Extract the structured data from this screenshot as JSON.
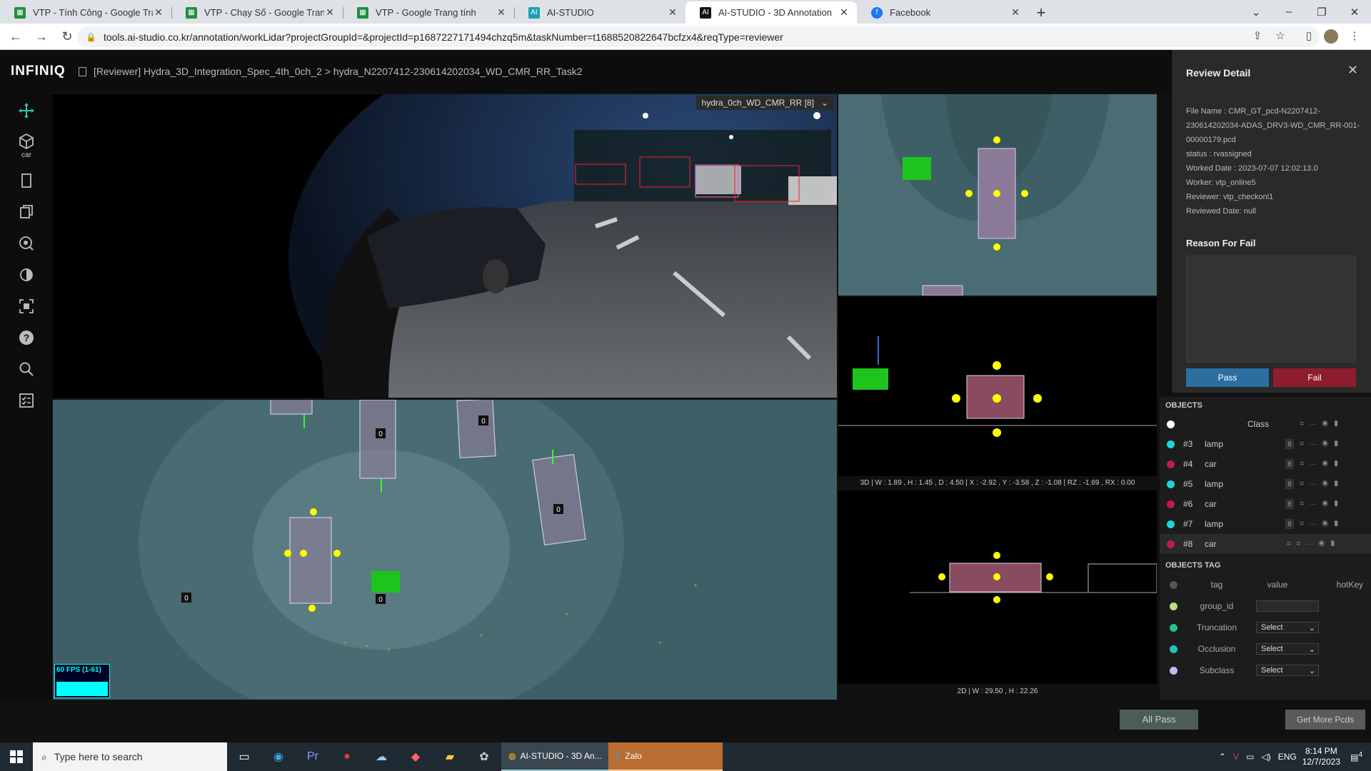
{
  "browser": {
    "tabs": [
      {
        "label": "VTP - Tính Công - Google Trang",
        "icon": "sheets-icon",
        "color": "#1e8e3e"
      },
      {
        "label": "VTP - Chạy Số - Google Trang tín",
        "icon": "sheets-icon",
        "color": "#1e8e3e"
      },
      {
        "label": "VTP - Google Trang tính",
        "icon": "sheets-icon",
        "color": "#1e8e3e"
      },
      {
        "label": "AI-STUDIO",
        "icon": "ai-studio-icon",
        "color": "#1a9fb0"
      },
      {
        "label": "AI-STUDIO - 3D Annotation",
        "icon": "ai-studio-icon",
        "color": "#1a9fb0"
      },
      {
        "label": "Facebook",
        "icon": "facebook-icon",
        "color": "#1877f2"
      }
    ],
    "url": "tools.ai-studio.co.kr/annotation/workLidar?projectGroupId=&projectId=p1687227171494chzq5m&taskNumber=t1688520822647bcfzx4&reqType=reviewer"
  },
  "app": {
    "logo": "INFINIQ",
    "breadcrumb": "[Reviewer] Hydra_3D_Integration_Spec_4th_0ch_2 > hydra_N2207412-230614202034_WD_CMR_RR_Task2",
    "tool_label_car": "car",
    "camera_select": "hydra_0ch_WD_CMR_RR [8]",
    "fps": "60 FPS (1-61)",
    "box_labels": [
      "0",
      "0",
      "0",
      "0",
      "0",
      "0"
    ],
    "info_3d": "3D | W : 1.89 , H : 1.45 , D : 4.50 | X : -2.92 , Y : -3.58 , Z : -1.08 | RZ : -1.69 , RX : 0.00",
    "info_2d": "2D | W : 29.50 , H : 22.26"
  },
  "review": {
    "title": "Review Detail",
    "file_name": "File Name : CMR_GT_pcd-N2207412-230614202034-ADAS_DRV3-WD_CMR_RR-001-00000179.pcd",
    "status": "status : rvassigned",
    "worked_date": "Worked Date : 2023-07-07 12:02:13.0",
    "worker": "Worker: vtp_online5",
    "reviewer": "Reviewer: vtp_checkonl1",
    "reviewed_date": "Reviewed Date: null",
    "reason_title": "Reason For Fail",
    "pass": "Pass",
    "fail": "Fail"
  },
  "objects": {
    "header": "OBJECTS",
    "class_col": "Class",
    "rows": [
      {
        "id": "#3",
        "cls": "lamp",
        "color": "#22d3e0",
        "hotkey": "8"
      },
      {
        "id": "#4",
        "cls": "car",
        "color": "#c2185b",
        "hotkey": "8"
      },
      {
        "id": "#5",
        "cls": "lamp",
        "color": "#22d3e0",
        "hotkey": "8"
      },
      {
        "id": "#6",
        "cls": "car",
        "color": "#c2185b",
        "hotkey": "8"
      },
      {
        "id": "#7",
        "cls": "lamp",
        "color": "#22d3e0",
        "hotkey": "8"
      },
      {
        "id": "#8",
        "cls": "car",
        "color": "#c2185b",
        "hotkey": ""
      }
    ]
  },
  "tags": {
    "header": "OBJECTS TAG",
    "col_tag": "tag",
    "col_value": "value",
    "col_hotkey": "hotKey",
    "rows": [
      {
        "name": "group_id",
        "color": "#b6e07a",
        "value": ""
      },
      {
        "name": "Truncation",
        "color": "#22c48a",
        "value": "Select"
      },
      {
        "name": "Occlusion",
        "color": "#22c4b5",
        "value": "Select"
      },
      {
        "name": "Subclass",
        "color": "#c8b8ef",
        "value": "Select"
      }
    ]
  },
  "bottom": {
    "all_pass": "All Pass",
    "get_more": "Get More Pcds"
  },
  "taskbar": {
    "search_placeholder": "Type here to search",
    "app1": "AI-STUDIO - 3D An...",
    "app2": "Zalo",
    "lang": "ENG",
    "time": "8:14 PM",
    "date": "12/7/2023",
    "notif": "4"
  }
}
